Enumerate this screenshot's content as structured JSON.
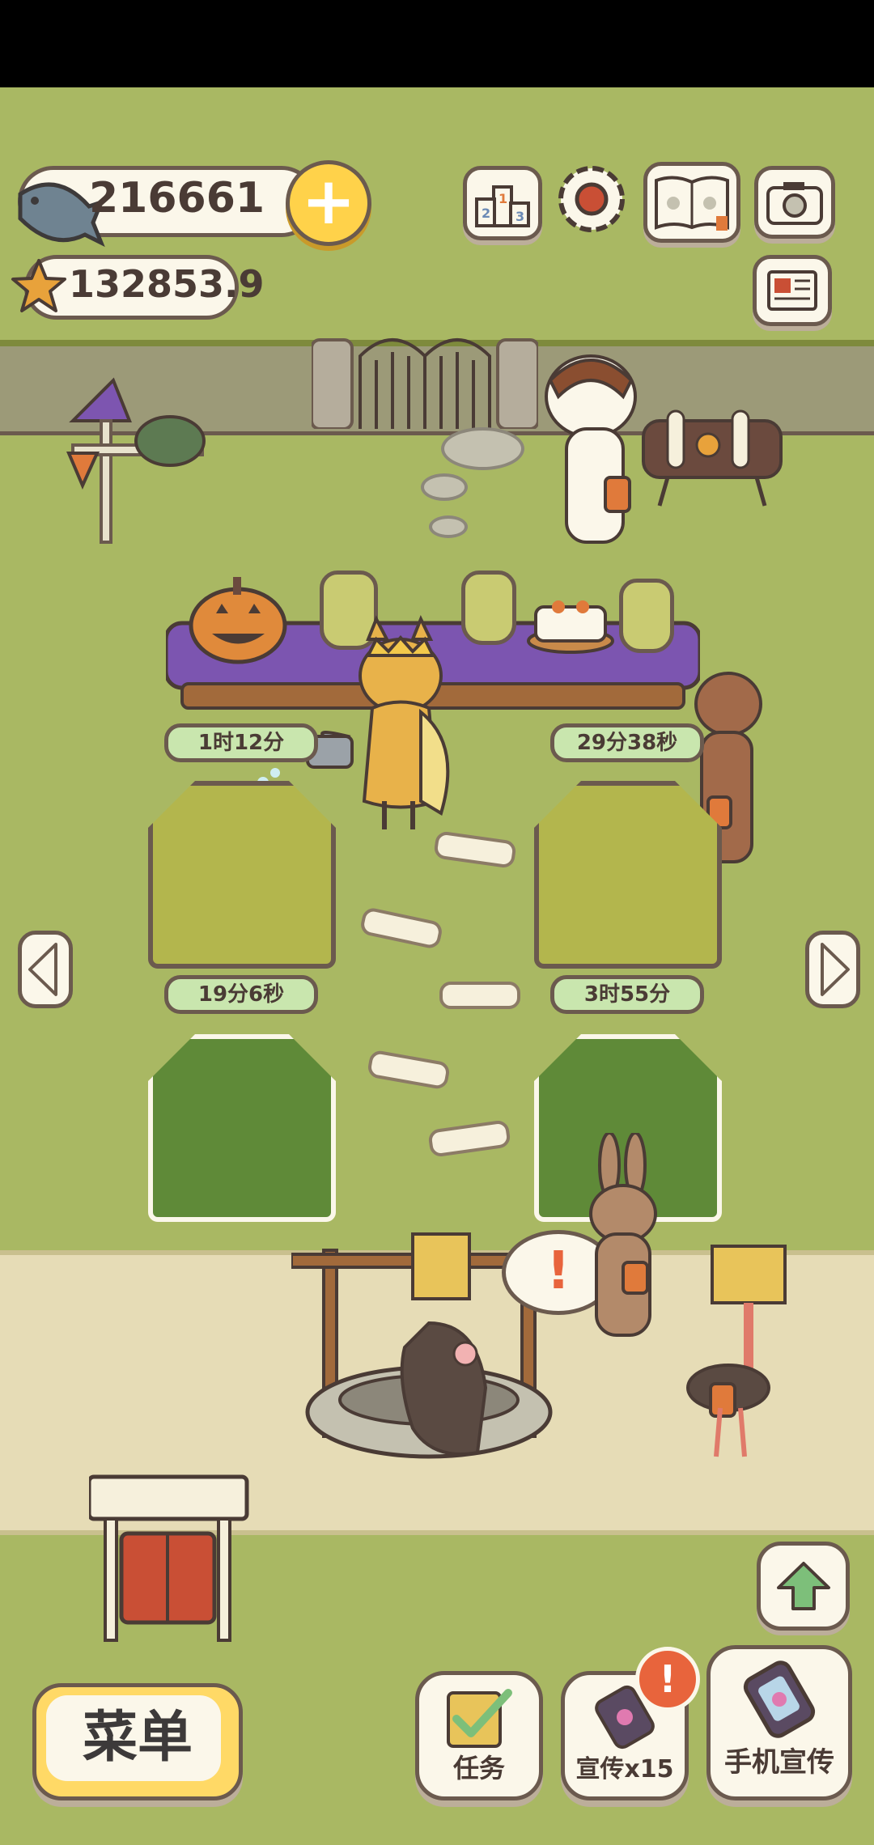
{
  "currency": {
    "fish_amount": "216661",
    "star_amount": "132853.9"
  },
  "timers": {
    "gh_top_left": "1时12分",
    "gh_top_right": "29分38秒",
    "gh_bottom_left": "19分6秒",
    "gh_bottom_right": "3时55分"
  },
  "buttons": {
    "menu_label": "菜单",
    "tasks_label": "任务",
    "promote_label": "宣传x15",
    "phone_promote_label": "手机宣传",
    "add_label": "+",
    "notice_mark": "!"
  },
  "colors": {
    "grass": "#a9b863",
    "path": "#e6dcb6",
    "outline": "#6b5a4e",
    "timer_bg": "#c9e6ae",
    "menu_yellow": "#ffd966",
    "notice_red": "#e8643c"
  }
}
